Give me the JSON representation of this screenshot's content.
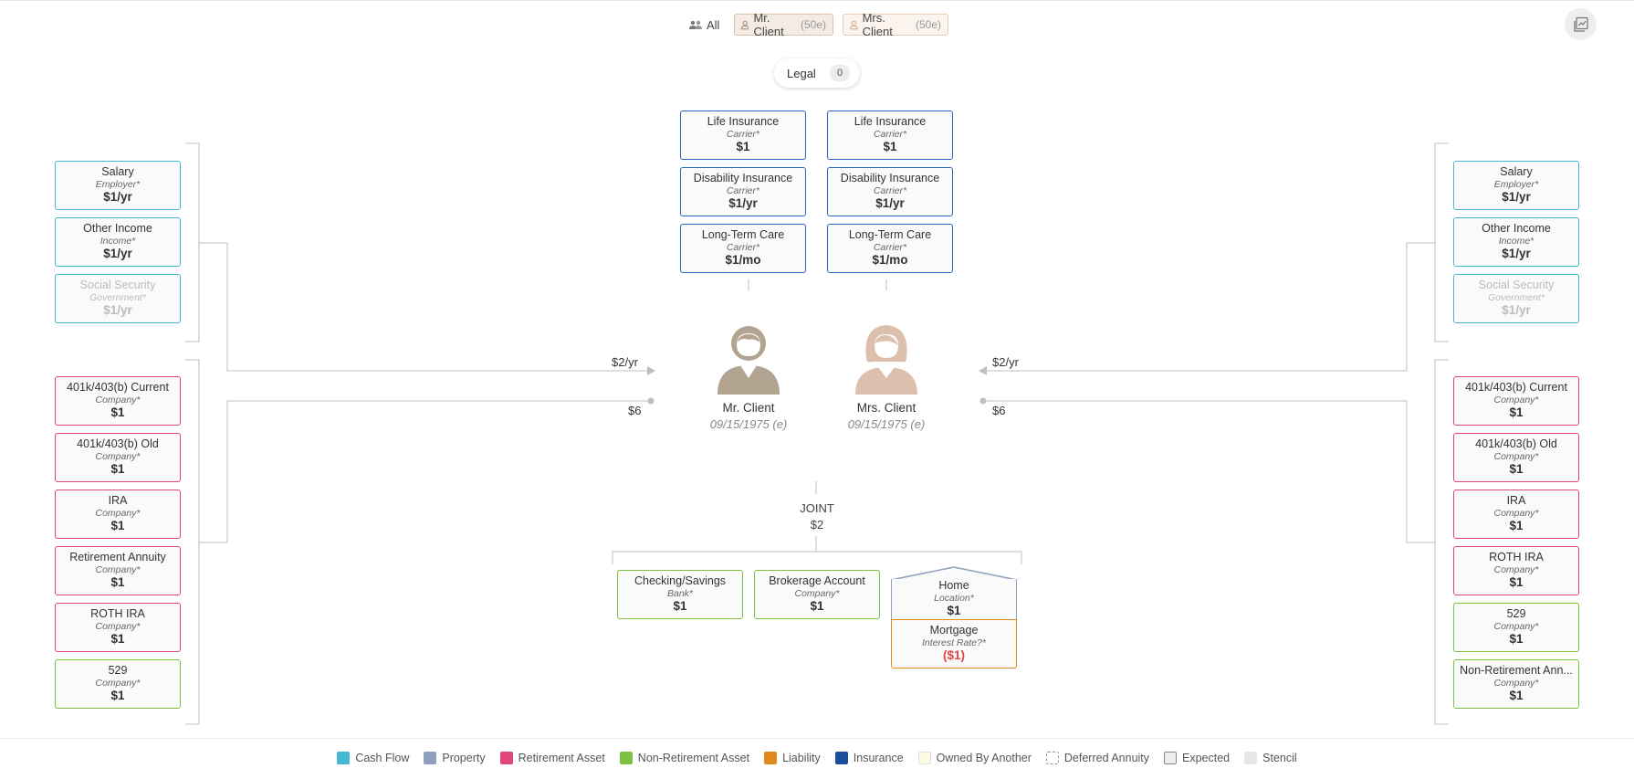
{
  "filters": {
    "all_label": "All",
    "mr_label": "Mr. Client",
    "mr_age": "(50e)",
    "mrs_label": "Mrs. Client",
    "mrs_age": "(50e)"
  },
  "legal": {
    "label": "Legal",
    "count": "0"
  },
  "insurance": {
    "mr": [
      {
        "title": "Life Insurance",
        "sub": "Carrier*",
        "value": "$1"
      },
      {
        "title": "Disability Insurance",
        "sub": "Carrier*",
        "value": "$1/yr"
      },
      {
        "title": "Long-Term Care",
        "sub": "Carrier*",
        "value": "$1/mo"
      }
    ],
    "mrs": [
      {
        "title": "Life Insurance",
        "sub": "Carrier*",
        "value": "$1"
      },
      {
        "title": "Disability Insurance",
        "sub": "Carrier*",
        "value": "$1/yr"
      },
      {
        "title": "Long-Term Care",
        "sub": "Carrier*",
        "value": "$1/mo"
      }
    ]
  },
  "left_income": [
    {
      "title": "Salary",
      "sub": "Employer*",
      "value": "$1/yr"
    },
    {
      "title": "Other Income",
      "sub": "Income*",
      "value": "$1/yr"
    },
    {
      "title": "Social Security",
      "sub": "Government*",
      "value": "$1/yr"
    }
  ],
  "left_assets": [
    {
      "title": "401k/403(b) Current",
      "sub": "Company*",
      "value": "$1"
    },
    {
      "title": "401k/403(b) Old",
      "sub": "Company*",
      "value": "$1"
    },
    {
      "title": "IRA",
      "sub": "Company*",
      "value": "$1"
    },
    {
      "title": "Retirement Annuity",
      "sub": "Company*",
      "value": "$1"
    },
    {
      "title": "ROTH IRA",
      "sub": "Company*",
      "value": "$1"
    },
    {
      "title": "529",
      "sub": "Company*",
      "value": "$1"
    }
  ],
  "right_income": [
    {
      "title": "Salary",
      "sub": "Employer*",
      "value": "$1/yr"
    },
    {
      "title": "Other Income",
      "sub": "Income*",
      "value": "$1/yr"
    },
    {
      "title": "Social Security",
      "sub": "Government*",
      "value": "$1/yr"
    }
  ],
  "right_assets": [
    {
      "title": "401k/403(b) Current",
      "sub": "Company*",
      "value": "$1"
    },
    {
      "title": "401k/403(b) Old",
      "sub": "Company*",
      "value": "$1"
    },
    {
      "title": "IRA",
      "sub": "Company*",
      "value": "$1"
    },
    {
      "title": "ROTH IRA",
      "sub": "Company*",
      "value": "$1"
    },
    {
      "title": "529",
      "sub": "Company*",
      "value": "$1"
    },
    {
      "title": "Non-Retirement Ann...",
      "sub": "Company*",
      "value": "$1"
    }
  ],
  "people": {
    "mr": {
      "name": "Mr. Client",
      "dob": "09/15/1975 (e)",
      "income_flow": "$2/yr",
      "asset_flow": "$6"
    },
    "mrs": {
      "name": "Mrs. Client",
      "dob": "09/15/1975 (e)",
      "income_flow": "$2/yr",
      "asset_flow": "$6"
    }
  },
  "joint": {
    "label": "JOINT",
    "value": "$2",
    "items": [
      {
        "title": "Checking/Savings",
        "sub": "Bank*",
        "value": "$1"
      },
      {
        "title": "Brokerage Account",
        "sub": "Company*",
        "value": "$1"
      }
    ],
    "home": {
      "title": "Home",
      "sub": "Location*",
      "value": "$1"
    },
    "mortgage": {
      "title": "Mortgage",
      "sub": "Interest Rate?*",
      "value": "($1)"
    }
  },
  "legend": [
    {
      "label": "Cash Flow",
      "color": "#44b8d0",
      "style": "fill"
    },
    {
      "label": "Property",
      "color": "#8f9fbf",
      "style": "fill"
    },
    {
      "label": "Retirement Asset",
      "color": "#e0457b",
      "style": "fill"
    },
    {
      "label": "Non-Retirement Asset",
      "color": "#7cc13f",
      "style": "fill"
    },
    {
      "label": "Liability",
      "color": "#e08a1e",
      "style": "fill"
    },
    {
      "label": "Insurance",
      "color": "#1d4f9c",
      "style": "fill"
    },
    {
      "label": "Owned By Another",
      "color": "#fdfbe3",
      "style": "outline"
    },
    {
      "label": "Deferred Annuity",
      "color": "#ffffff",
      "style": "dashed"
    },
    {
      "label": "Expected",
      "color": "#eeeeee",
      "style": "outline"
    },
    {
      "label": "Stencil",
      "color": "#e6e6e6",
      "style": "fill"
    }
  ],
  "colors": {
    "mr_avatar": "#b3a492",
    "mrs_avatar": "#dcc0ad"
  }
}
